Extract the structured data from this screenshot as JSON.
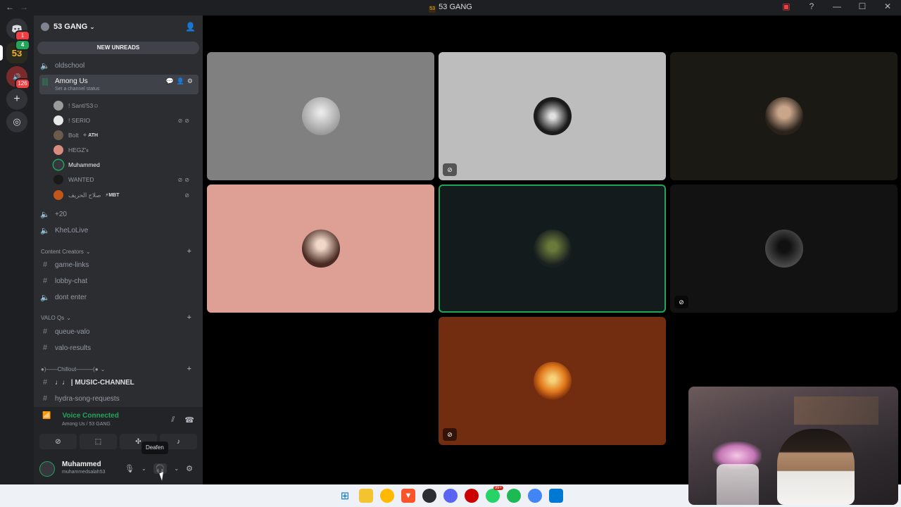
{
  "window": {
    "title": "53 GANG",
    "server_mini_label": "53"
  },
  "rail": {
    "home_badge": "1",
    "server_label": "53",
    "server_badge": "4",
    "server2_badge": "126"
  },
  "server": {
    "name": "53 GANG",
    "new_unreads": "NEW UNREADS"
  },
  "channels": {
    "oldschool": "oldschool",
    "among_us": "Among Us",
    "among_us_status": "Set a channel status",
    "plus20": "+20",
    "khelolive": "KheLoLive",
    "cat_content": "Content Creators",
    "game_links": "game-links",
    "lobby_chat": "lobby-chat",
    "dont_enter": "dont enter",
    "cat_valo": "VALO Qs",
    "queue_valo": "queue-valo",
    "valo_results": "valo-results",
    "cat_chillout": "●)——Chillout———(●",
    "music_channel": "♩♩ | MUSIC-CHANNEL",
    "hydra_requests": "hydra-song-requests"
  },
  "voice_users": [
    {
      "name": "! Santi'53☺",
      "tag": "",
      "color": "#9a9a9a"
    },
    {
      "name": "! SERIO",
      "tag": "",
      "color": "#e8e8e8"
    },
    {
      "name": "Bolt",
      "tag": "✧ ATH",
      "color": "#6b5b4b"
    },
    {
      "name": "HEGZ'ء",
      "tag": "",
      "color": "#d98b7f"
    },
    {
      "name": "Muhammed",
      "tag": "",
      "color": "#35373c"
    },
    {
      "name": "WANTED",
      "tag": "",
      "color": "#1a1a1a"
    },
    {
      "name": "صلاح الحريف",
      "tag": "⚡MBT",
      "color": "#c0561a"
    }
  ],
  "voice": {
    "status": "Voice Connected",
    "channel": "Among Us / 53 GANG",
    "tooltip": "Deafen"
  },
  "user": {
    "name": "Muhammed",
    "handle": "muhammedsalah53"
  },
  "tiles": [
    {
      "bg": "#808080",
      "avatar": "#e0e0e0",
      "muted_video": false,
      "speaking": false
    },
    {
      "bg": "#bdbdbd",
      "avatar": "#1b1b1b",
      "muted_video": true,
      "speaking": false
    },
    {
      "bg": "#1a1914",
      "avatar": "#3a2d22",
      "muted_video": false,
      "speaking": false
    },
    {
      "bg": "#dea095",
      "avatar": "#4a2b22",
      "muted_video": false,
      "speaking": false
    },
    {
      "bg": "#141b1c",
      "avatar": "#3a4a2a",
      "muted_video": false,
      "speaking": true
    },
    {
      "bg": "#121212",
      "avatar": "#3b3b3b",
      "muted_video": true,
      "speaking": false
    },
    {
      "bg": "#722c10",
      "avatar": "#e27a1c",
      "muted_video": true,
      "speaking": false
    }
  ],
  "icons": {
    "back": "←",
    "forward": "→",
    "voice": "🔊",
    "text": "#",
    "mic": "🎙",
    "headphones": "🎧",
    "gear": "⚙",
    "signal": "📶",
    "disconnect": "☎",
    "mute_slash": "⊘"
  },
  "taskbar_badges": {
    "whatsapp": "99+"
  }
}
